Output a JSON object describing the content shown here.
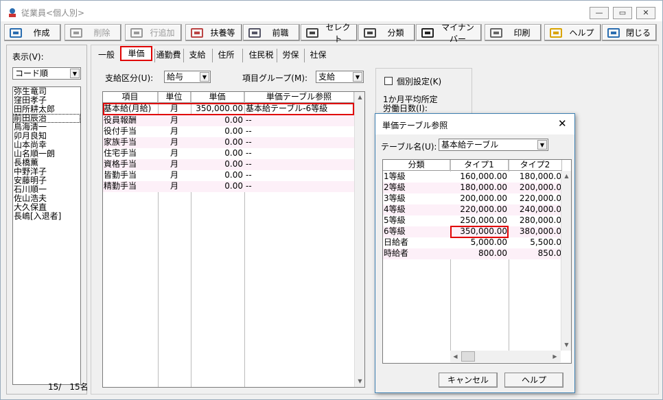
{
  "window": {
    "title": "従業員<個人別>",
    "min_icon": "minimize-icon",
    "max_icon": "maximize-icon",
    "close_icon": "close-icon"
  },
  "toolbar": [
    {
      "name": "create-button",
      "icon": "edit-card-icon",
      "label": "作成",
      "disabled": false
    },
    {
      "name": "delete-button",
      "icon": "trash-icon",
      "label": "削除",
      "disabled": true
    },
    {
      "name": "add-row-button",
      "icon": "table-icon",
      "label": "行追加",
      "disabled": true
    },
    {
      "name": "dependents-button",
      "icon": "people-icon",
      "label": "扶養等",
      "disabled": false
    },
    {
      "name": "previous-job-button",
      "icon": "building-icon",
      "label": "前職",
      "disabled": false
    },
    {
      "name": "select-button",
      "icon": "select-icon",
      "label": "セレクト",
      "disabled": false
    },
    {
      "name": "classify-button",
      "icon": "classify-icon",
      "label": "分類",
      "disabled": false
    },
    {
      "name": "my-number-button",
      "icon": "number-icon",
      "label": "マイナンバー",
      "disabled": false
    },
    {
      "name": "print-button",
      "icon": "printer-icon",
      "label": "印刷",
      "disabled": false
    },
    {
      "name": "help-button",
      "icon": "lightbulb-icon",
      "label": "ヘルプ",
      "disabled": false
    },
    {
      "name": "close-button",
      "icon": "door-icon",
      "label": "閉じる",
      "disabled": false
    }
  ],
  "left": {
    "display_label": "表示(V):",
    "sort_value": "コード順",
    "employees": [
      "弥生竜司",
      "窪田孝子",
      "田所耕太郎",
      "前田辰治",
      "鳥海清一",
      "卯月良知",
      "山本尚幸",
      "山名順一朗",
      "長橋薫",
      "中野洋子",
      "安藤明子",
      "石川順一",
      "佐山浩夫",
      "大久保直",
      "長嶋[入退者]"
    ],
    "selected_index": 3,
    "count_text": "15/　15名"
  },
  "tabs": [
    "一般",
    "単価",
    "通勤費",
    "支給",
    "住所",
    "住民税",
    "労保",
    "社保"
  ],
  "active_tab": 1,
  "main": {
    "pay_type_label": "支給区分(U):",
    "pay_type_value": "給与",
    "item_group_label": "項目グループ(M):",
    "item_group_value": "支給",
    "columns": [
      "項目",
      "単位",
      "単価",
      "単価テーブル参照"
    ],
    "rows": [
      {
        "item": "基本給(月給)",
        "unit": "月",
        "price": "350,000.00",
        "ref": "基本給テーブル-6等級"
      },
      {
        "item": "役員報酬",
        "unit": "月",
        "price": "0.00",
        "ref": "--"
      },
      {
        "item": "役付手当",
        "unit": "月",
        "price": "0.00",
        "ref": "--"
      },
      {
        "item": "家族手当",
        "unit": "月",
        "price": "0.00",
        "ref": "--"
      },
      {
        "item": "住宅手当",
        "unit": "月",
        "price": "0.00",
        "ref": "--"
      },
      {
        "item": "資格手当",
        "unit": "月",
        "price": "0.00",
        "ref": "--"
      },
      {
        "item": "皆勤手当",
        "unit": "月",
        "price": "0.00",
        "ref": "--"
      },
      {
        "item": "精勤手当",
        "unit": "月",
        "price": "0.00",
        "ref": "--"
      }
    ]
  },
  "right": {
    "individual_label": "個別設定(K)",
    "avg_label_1": "1か月平均所定",
    "avg_label_2": "労働日数(I):"
  },
  "dialog": {
    "title": "単価テーブル参照",
    "table_name_label": "テーブル名(U):",
    "table_name_value": "基本給テーブル",
    "columns": [
      "分類",
      "タイプ1",
      "タイプ2"
    ],
    "rows": [
      {
        "cls": "1等級",
        "t1": "160,000.00",
        "t2": "180,000.0"
      },
      {
        "cls": "2等級",
        "t1": "180,000.00",
        "t2": "200,000.0"
      },
      {
        "cls": "3等級",
        "t1": "200,000.00",
        "t2": "220,000.0"
      },
      {
        "cls": "4等級",
        "t1": "220,000.00",
        "t2": "240,000.0"
      },
      {
        "cls": "5等級",
        "t1": "250,000.00",
        "t2": "280,000.0"
      },
      {
        "cls": "6等級",
        "t1": "350,000.00",
        "t2": "380,000.0"
      },
      {
        "cls": "日給者",
        "t1": "5,000.00",
        "t2": "5,500.0"
      },
      {
        "cls": "時給者",
        "t1": "800.00",
        "t2": "850.0"
      }
    ],
    "cancel_label": "キャンセル",
    "help_label": "ヘルプ"
  },
  "colors": {
    "highlight_row": "#fde8f4",
    "red_box": "#e00000",
    "selection": "#0078d7"
  }
}
